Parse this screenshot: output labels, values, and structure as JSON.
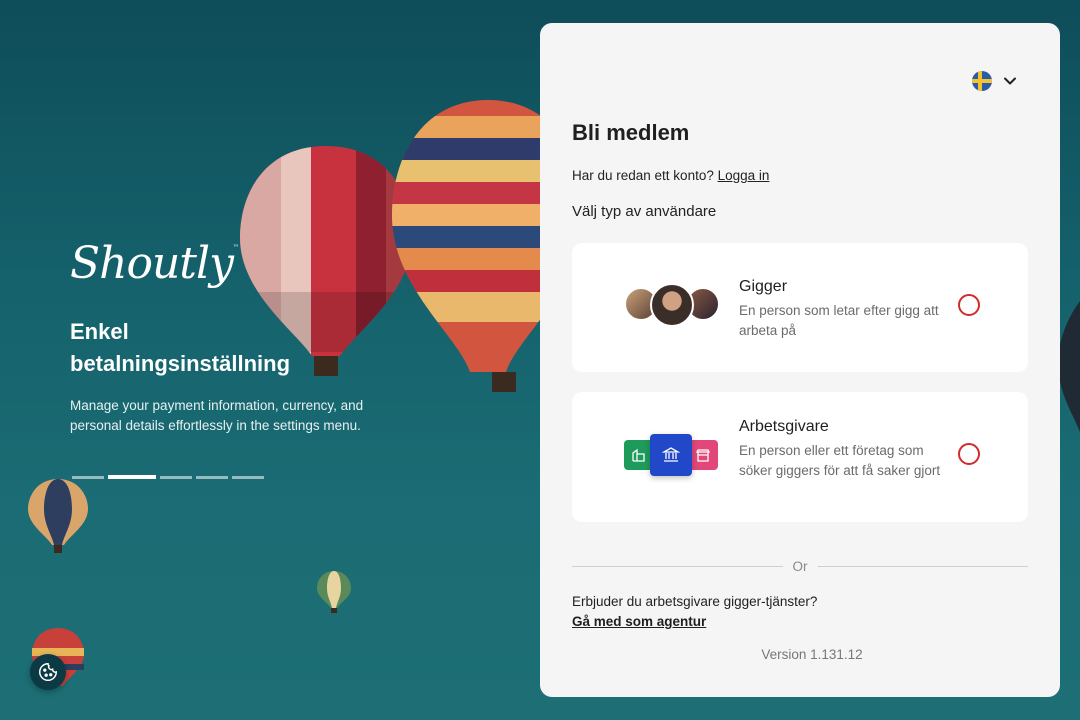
{
  "hero": {
    "logo": "Shoutly",
    "logo_tm": "™",
    "title": "Enkel betalningsinställning",
    "text": "Manage your payment information, currency, and personal details effortlessly in the settings menu.",
    "slides_total": 5,
    "active_slide": 2
  },
  "language": {
    "flag": "sweden-flag-icon",
    "chevron": "chevron-down-icon"
  },
  "signup": {
    "title": "Bli medlem",
    "have_account": "Har du redan ett konto?",
    "login_link": "Logga in",
    "choose_type": "Välj typ av användare",
    "options": [
      {
        "title": "Gigger",
        "description": "En person som letar efter gigg att arbeta på",
        "selected": false
      },
      {
        "title": "Arbetsgivare",
        "description": "En person eller ett företag som söker giggers för att få saker gjort",
        "selected": false
      }
    ],
    "or": "Or",
    "agency_question": "Erbjuder du arbetsgivare gigger-tjänster?",
    "agency_link": "Gå med som agentur",
    "version": "Version 1.131.12"
  },
  "colors": {
    "accent_red": "#d42a2a",
    "employer_green": "#1e9b5a",
    "employer_blue": "#2148c9",
    "employer_pink": "#e2477a"
  }
}
